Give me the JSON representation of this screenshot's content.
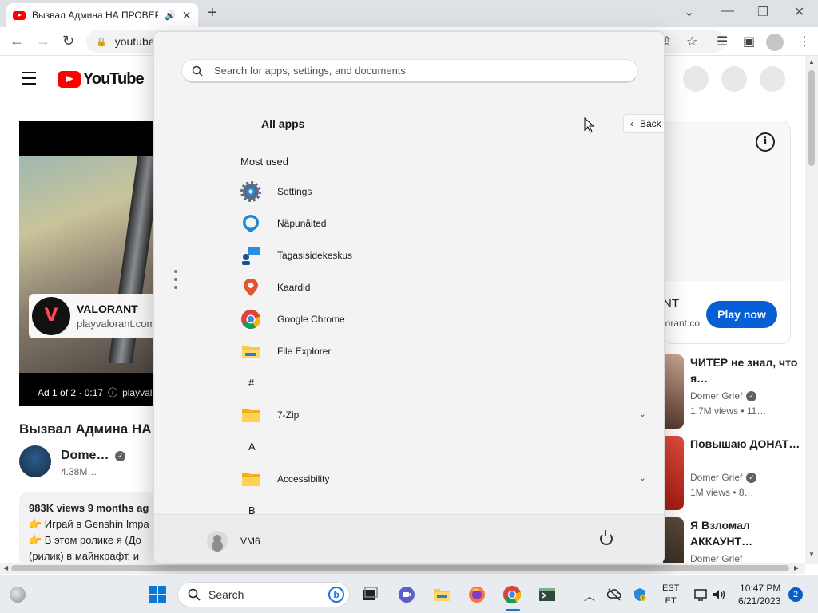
{
  "browser": {
    "tab_title": "Вызвал Админа НА ПРОВЕР",
    "tab_audio": "🔊",
    "tab_close": "✕",
    "new_tab": "+",
    "url": "youtube",
    "win_minimize": "—",
    "win_restore": "❐",
    "win_close": "✕"
  },
  "youtube": {
    "logo_text": "YouTube",
    "ad": {
      "title": "VALORANT",
      "url": "playvalorant.com",
      "bar_text": "Ad 1 of 2 · 0:17",
      "bar_info": "ⓘ",
      "bar_url": "playval"
    },
    "video_title": "Вызвал Админа НА",
    "channel": {
      "name": "Dome…",
      "subs": "4.38M…"
    },
    "description": {
      "meta": "983K views  9 months ag",
      "line1": "👉 Играй в Genshin Impa",
      "line2": "👉  В этом ролике я (До",
      "line3": "(рилик) в майнкрафт, и"
    },
    "side_ad": {
      "title": "NT",
      "url": "lorant.co",
      "button": "Play now",
      "info": "i"
    },
    "recommendations": [
      {
        "title": "ЧИТЕР не знал, что я…",
        "channel": "Domer Grief",
        "views": "1.7M views  • 11…"
      },
      {
        "title": "Повышаю ДОНАТ…",
        "channel": "Domer Grief",
        "views": "1M views  • 8…"
      },
      {
        "title": "Я Взломал АККАУНТ…",
        "channel": "Domer Grief",
        "views": ""
      }
    ]
  },
  "start_menu": {
    "search_placeholder": "Search for apps, settings, and documents",
    "all_apps": "All apps",
    "back": "Back",
    "most_used": "Most used",
    "apps": [
      {
        "label": "Settings",
        "icon": "settings-gear-icon"
      },
      {
        "label": "Näpunäited",
        "icon": "tips-bulb-icon"
      },
      {
        "label": "Tagasisidekeskus",
        "icon": "feedback-hub-icon"
      },
      {
        "label": "Kaardid",
        "icon": "maps-pin-icon"
      },
      {
        "label": "Google Chrome",
        "icon": "chrome-icon"
      },
      {
        "label": "File Explorer",
        "icon": "file-explorer-icon"
      }
    ],
    "letter_hash": "#",
    "folder_7zip": "7-Zip",
    "letter_a": "A",
    "folder_accessibility": "Accessibility",
    "letter_b": "B",
    "user": "VM6"
  },
  "taskbar": {
    "search": "Search",
    "lang_top": "EST",
    "lang_bottom": "ET",
    "time": "10:47 PM",
    "date": "6/21/2023",
    "notifications": "2"
  },
  "colors": {
    "youtube_red": "#ff0000",
    "play_button": "#065fd4",
    "windows_blue": "#0a78d4"
  }
}
